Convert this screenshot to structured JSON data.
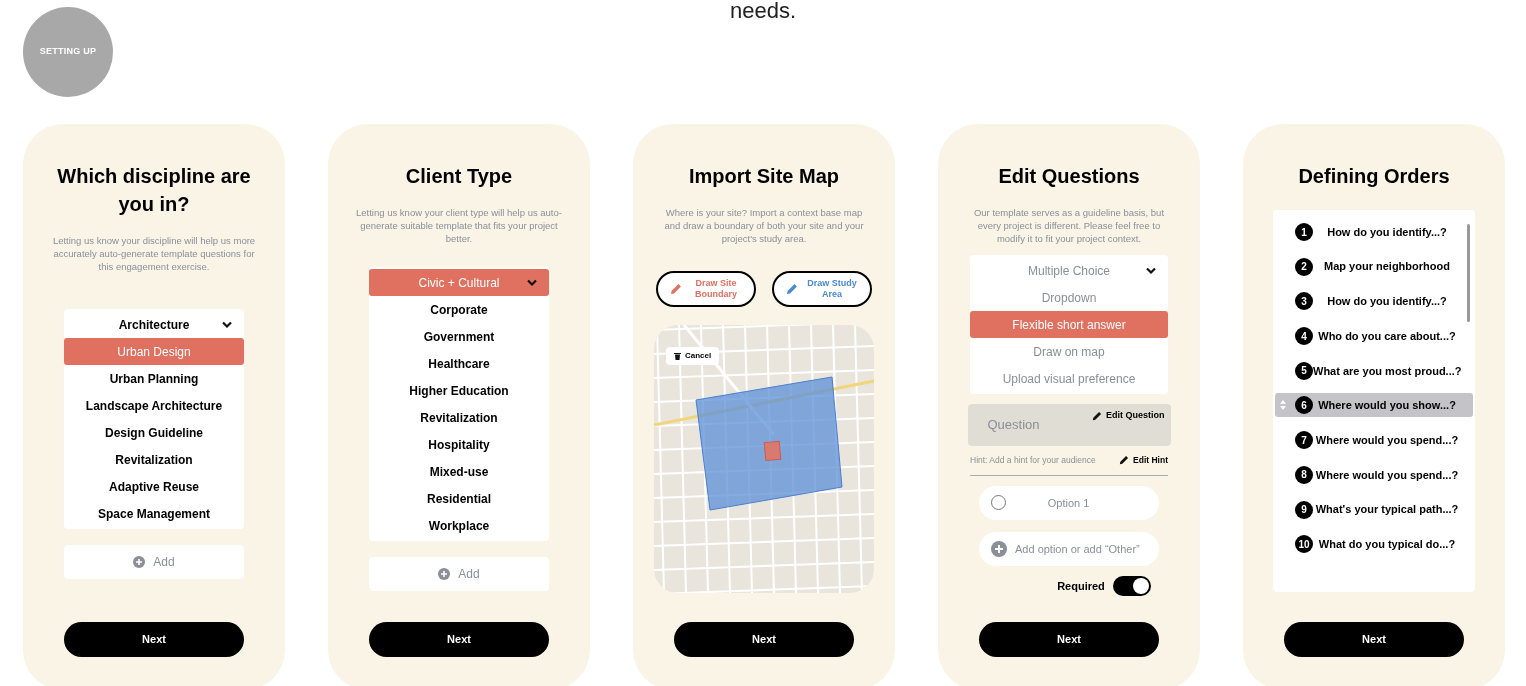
{
  "header": {
    "text": "needs."
  },
  "badge": {
    "label": "SETTING UP"
  },
  "cards": [
    {
      "kind": "select",
      "title": "Which discipline are you in?",
      "description": "Letting us know your discipline will help us more accurately auto-generate template questions for this engagement exercise.",
      "dropdown": {
        "expanded": true,
        "options": [
          {
            "label": "Architecture",
            "selected": false
          },
          {
            "label": "Urban Design",
            "selected": true
          },
          {
            "label": "Urban Planning",
            "selected": false
          },
          {
            "label": "Landscape Architecture",
            "selected": false
          },
          {
            "label": "Design Guideline",
            "selected": false
          },
          {
            "label": "Revitalization",
            "selected": false
          },
          {
            "label": "Adaptive Reuse",
            "selected": false
          },
          {
            "label": "Space Management",
            "selected": false
          }
        ]
      },
      "add_button": "Add",
      "next_button": "Next"
    },
    {
      "kind": "select",
      "title": "Client Type",
      "description": "Letting us know your client type will help us auto-generate suitable template that fits your project better.",
      "dropdown": {
        "expanded": true,
        "options": [
          {
            "label": "Civic + Cultural",
            "selected": true
          },
          {
            "label": "Corporate",
            "selected": false
          },
          {
            "label": "Government",
            "selected": false
          },
          {
            "label": "Healthcare",
            "selected": false
          },
          {
            "label": "Higher Education",
            "selected": false
          },
          {
            "label": "Revitalization",
            "selected": false
          },
          {
            "label": "Hospitality",
            "selected": false
          },
          {
            "label": "Mixed-use",
            "selected": false
          },
          {
            "label": "Residential",
            "selected": false
          },
          {
            "label": "Workplace",
            "selected": false
          }
        ]
      },
      "add_button": "Add",
      "next_button": "Next"
    },
    {
      "kind": "map",
      "title": "Import Site Map",
      "description": "Where is your site? Import a context base map and draw a boundary of both your site and your project's study area.",
      "draw_buttons": [
        {
          "label": "Draw Site Boundary",
          "color": "#e07060"
        },
        {
          "label": "Draw Study Area",
          "color": "#4a88d8"
        }
      ],
      "map": {
        "cancel_button": "Cancel"
      },
      "next_button": "Next"
    },
    {
      "kind": "questions",
      "title": "Edit Questions",
      "description": "Our template serves as a guideline basis, but every project is different. Please feel free to modify it to fit your project context.",
      "dropdown": {
        "expanded": true,
        "options": [
          {
            "label": "Multiple Choice",
            "selected": false
          },
          {
            "label": "Dropdown",
            "selected": false
          },
          {
            "label": "Flexible short answer",
            "selected": true
          },
          {
            "label": "Draw on map",
            "selected": false
          },
          {
            "label": "Upload visual preference",
            "selected": false
          }
        ]
      },
      "question": {
        "placeholder": "Question",
        "edit_label": "Edit Question"
      },
      "hint": {
        "text": "Hint: Add a hint for your audience",
        "edit_label": "Edit Hint"
      },
      "options": [
        {
          "label": "Option 1",
          "checked": false
        }
      ],
      "add_option": "Add option or add “Other”",
      "required": {
        "label": "Required",
        "on": true
      },
      "next_button": "Next"
    },
    {
      "kind": "orders",
      "title": "Defining Orders",
      "orders": [
        {
          "number": "1",
          "label": "How do you identify...?",
          "selected": false
        },
        {
          "number": "2",
          "label": "Map your neighborhood",
          "selected": false
        },
        {
          "number": "3",
          "label": "How do you identify...?",
          "selected": false
        },
        {
          "number": "4",
          "label": "Who do you care about...?",
          "selected": false
        },
        {
          "number": "5",
          "label": "What are you most proud...?",
          "selected": false
        },
        {
          "number": "6",
          "label": "Where would you show...?",
          "selected": true
        },
        {
          "number": "7",
          "label": "Where would you spend...?",
          "selected": false
        },
        {
          "number": "8",
          "label": "Where would you spend...?",
          "selected": false
        },
        {
          "number": "9",
          "label": "What's your typical path...?",
          "selected": false
        },
        {
          "number": "10",
          "label": "What do you typical do...?",
          "selected": false
        }
      ],
      "next_button": "Next"
    }
  ]
}
